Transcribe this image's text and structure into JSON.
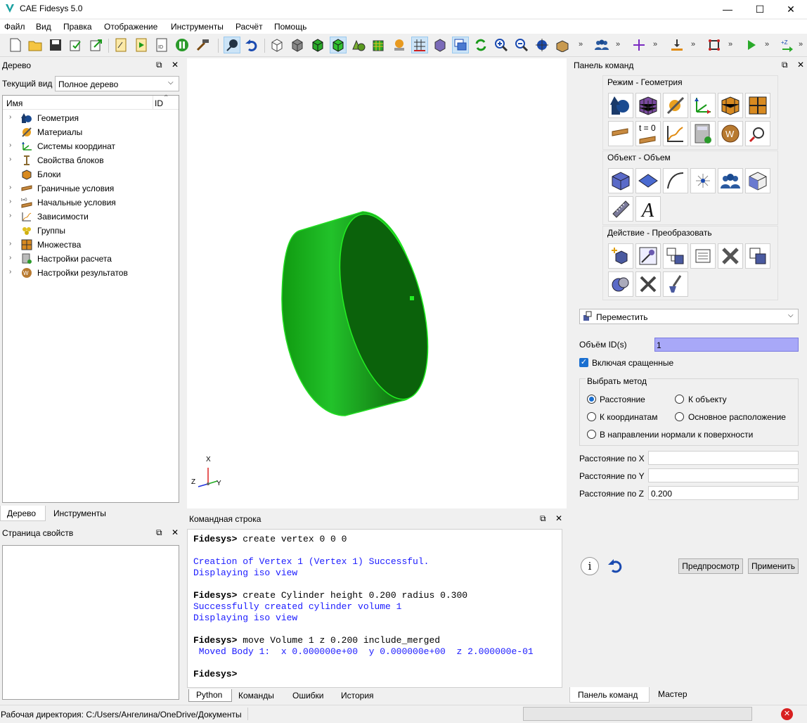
{
  "app": {
    "title": "CAE Fidesys 5.0"
  },
  "window_controls": {
    "minimize": "—",
    "maximize": "☐",
    "close": "✕"
  },
  "menu": [
    "Файл",
    "Вид",
    "Правка",
    "Отображение",
    "Инструменты",
    "Расчёт",
    "Помощь"
  ],
  "tree_panel": {
    "title": "Дерево",
    "current_view_label": "Текущий вид",
    "current_view_value": "Полное дерево",
    "col_name": "Имя",
    "col_id": "ID",
    "items": [
      {
        "label": "Геометрия",
        "expandable": true,
        "icon": "geometry-icon"
      },
      {
        "label": "Материалы",
        "expandable": false,
        "icon": "materials-icon"
      },
      {
        "label": "Системы координат",
        "expandable": true,
        "icon": "coordinate-systems-icon"
      },
      {
        "label": "Свойства блоков",
        "expandable": true,
        "icon": "block-properties-icon"
      },
      {
        "label": "Блоки",
        "expandable": false,
        "icon": "blocks-icon"
      },
      {
        "label": "Граничные условия",
        "expandable": true,
        "icon": "boundary-conditions-icon"
      },
      {
        "label": "Начальные условия",
        "expandable": true,
        "icon": "initial-conditions-icon"
      },
      {
        "label": "Зависимости",
        "expandable": true,
        "icon": "dependencies-icon"
      },
      {
        "label": "Группы",
        "expandable": false,
        "icon": "groups-icon"
      },
      {
        "label": "Множества",
        "expandable": true,
        "icon": "sets-icon"
      },
      {
        "label": "Настройки расчета",
        "expandable": true,
        "icon": "calc-settings-icon"
      },
      {
        "label": "Настройки результатов",
        "expandable": true,
        "icon": "results-settings-icon"
      }
    ],
    "tabs": [
      "Дерево",
      "Инструменты"
    ]
  },
  "props_panel": {
    "title": "Страница свойств"
  },
  "viewport": {
    "axis_x": "X",
    "axis_y": "Y",
    "axis_z": "Z",
    "shape_color": "#22bb00"
  },
  "command_line": {
    "title": "Командная строка",
    "lines": [
      {
        "text": "Fidesys> create vertex 0 0 0",
        "kind": "prompt"
      },
      {
        "text": "Creation of Vertex 1 (Vertex 1) Successful.",
        "kind": "out"
      },
      {
        "text": "Displaying iso view",
        "kind": "out"
      },
      {
        "text": "Fidesys> create Cylinder height 0.200 radius 0.300",
        "kind": "prompt"
      },
      {
        "text": "Successfully created cylinder volume 1",
        "kind": "out"
      },
      {
        "text": "Displaying iso view",
        "kind": "out"
      },
      {
        "text": "Fidesys> move Volume 1 z 0.200 include_merged",
        "kind": "prompt"
      },
      {
        "text": " Moved Body 1:  x 0.000000e+00  y 0.000000e+00  z 2.000000e-01",
        "kind": "out"
      },
      {
        "text": "Fidesys>",
        "kind": "prompt"
      }
    ],
    "tabs": [
      "Python",
      "Команды",
      "Ошибки",
      "История"
    ]
  },
  "cmd_panel": {
    "title": "Панель команд",
    "section_mode": "Режим - Геометрия",
    "section_object": "Объект - Объем",
    "section_action": "Действие - Преобразовать",
    "t0_label": "t = 0",
    "operation": "Переместить",
    "volume_ids_label": "Объём ID(s)",
    "volume_ids_value": "1",
    "include_merged_label": "Включая сращенные",
    "include_merged": true,
    "method_group": "Выбрать метод",
    "methods": [
      "Расстояние",
      "К объекту",
      "К координатам",
      "Основное расположение",
      "В направлении нормали к поверхности"
    ],
    "selected_method": "Расстояние",
    "dist_x_label": "Расстояние по X",
    "dist_y_label": "Расстояние по Y",
    "dist_z_label": "Расстояние по Z",
    "dist_x": "",
    "dist_y": "",
    "dist_z": "0.200",
    "preview_label": "Предпросмотр",
    "apply_label": "Применить",
    "tabs": [
      "Панель команд",
      "Мастер"
    ]
  },
  "status": {
    "workdir": "Рабочая директория: C:/Users/Ангелина/OneDrive/Документы"
  }
}
